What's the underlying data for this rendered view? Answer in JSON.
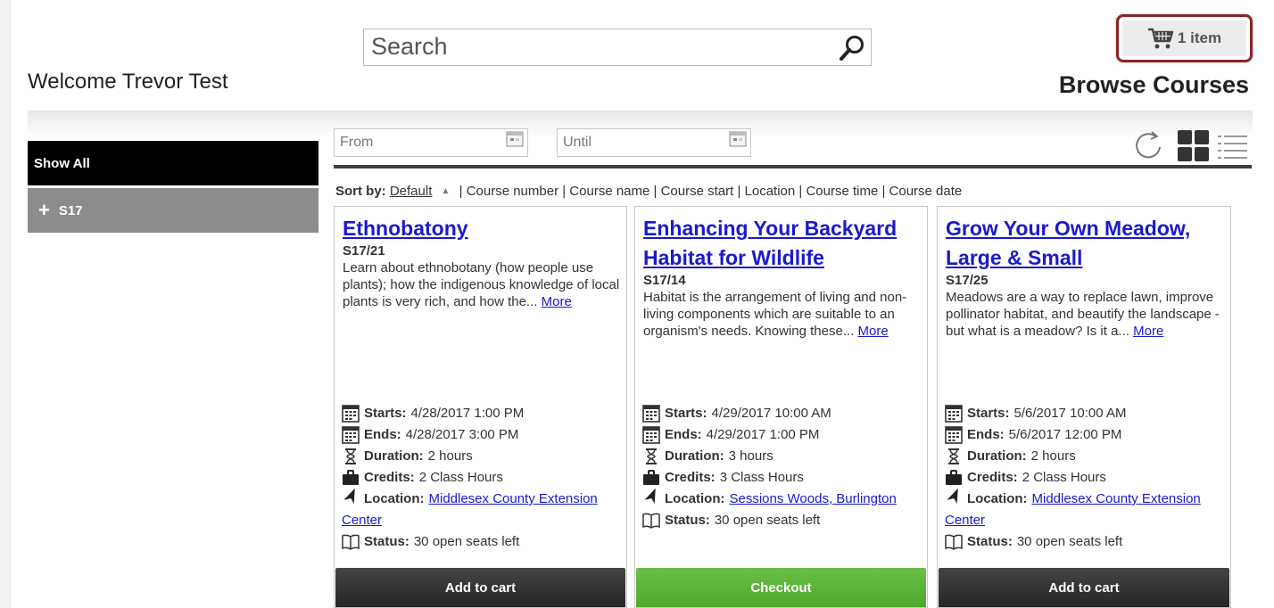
{
  "header": {
    "welcome": "Welcome Trevor Test",
    "search_placeholder": "Search",
    "cart_label": "1 item",
    "page_title": "Browse Courses"
  },
  "sidebar": {
    "show_all": "Show All",
    "group_plus": "+",
    "group_label": "S17"
  },
  "filters": {
    "from_placeholder": "From",
    "until_placeholder": "Until"
  },
  "sort": {
    "label": "Sort by:",
    "default": "Default",
    "options_text": "| Course number | Course name | Course start | Location | Course time | Course date"
  },
  "labels": {
    "starts": "Starts:",
    "ends": "Ends:",
    "duration": "Duration:",
    "credits": "Credits:",
    "location": "Location:",
    "status": "Status:",
    "more": "More"
  },
  "courses": [
    {
      "title": "Ethnobatony",
      "code": "S17/21",
      "description": "Learn about ethnobotany (how people use plants); how the indigenous knowledge of local plants is very rich, and how the...",
      "starts": "4/28/2017 1:00 PM",
      "ends": "4/28/2017 3:00 PM",
      "duration": "2 hours",
      "credits": "2 Class Hours",
      "location": "Middlesex County Extension Center",
      "status": "30 open seats left",
      "button": "Add to cart"
    },
    {
      "title": "Enhancing Your Backyard Habitat for Wildlife",
      "code": "S17/14",
      "description": "Habitat is the arrangement of living and non-living components which are suitable to an organism's needs. Knowing these...",
      "starts": "4/29/2017 10:00 AM",
      "ends": "4/29/2017 1:00 PM",
      "duration": "3 hours",
      "credits": "3 Class Hours",
      "location": "Sessions Woods, Burlington",
      "status": "30 open seats left",
      "button": "Checkout"
    },
    {
      "title": "Grow Your Own Meadow, Large & Small",
      "code": "S17/25",
      "description": "Meadows are a way to replace lawn, improve pollinator habitat, and beautify the landscape - but what is a meadow? Is it a...",
      "starts": "5/6/2017 10:00 AM",
      "ends": "5/6/2017 12:00 PM",
      "duration": "2 hours",
      "credits": "2 Class Hours",
      "location": "Middlesex County Extension Center",
      "status": "30 open seats left",
      "button": "Add to cart"
    }
  ],
  "icons": {
    "search": "search-icon",
    "cart": "shopping-cart-icon",
    "calendar": "calendar-icon",
    "refresh": "refresh-icon",
    "grid_view": "grid-view-icon",
    "list_view": "list-view-icon",
    "hourglass": "hourglass-icon",
    "briefcase": "briefcase-icon",
    "location_arrow": "location-arrow-icon",
    "book": "book-icon"
  },
  "colors": {
    "link": "#1a1acc",
    "cart_border": "#8e2427",
    "checkout_green": "#5cb338",
    "dark_button": "#333333",
    "sidebar_active": "#000000",
    "sidebar_group": "#8c8c8c"
  }
}
